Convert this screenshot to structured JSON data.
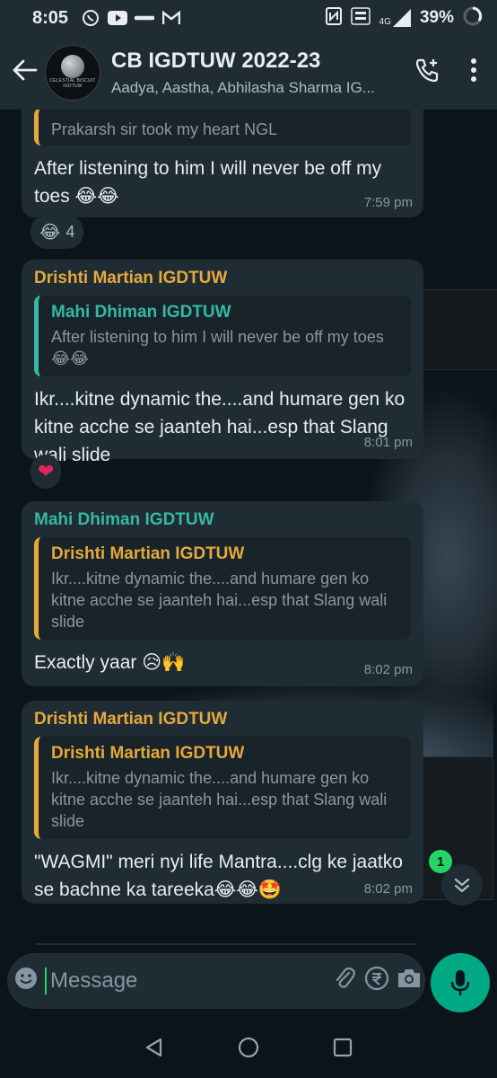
{
  "status_bar": {
    "time": "8:05",
    "network": "4G",
    "battery": "39%"
  },
  "header": {
    "title": "CB IGDTUW 2022-23",
    "subtitle": "Aadya, Aastha, Abhilasha Sharma IG...",
    "avatar_text": "CELESTIAL BISCUIT IGDTUW"
  },
  "messages": [
    {
      "quote_text": "Prakarsh sir took my heart NGL",
      "text": "After listening to him I will never be off my toes 😂😂",
      "time": "7:59 pm",
      "reaction_emoji": "😂",
      "reaction_count": "4"
    },
    {
      "sender": "Drishti Martian IGDTUW",
      "quote_sender": "Mahi Dhiman IGDTUW",
      "quote_text": "After listening to him I will never be off my toes 😂😂",
      "text": "Ikr....kitne dynamic the....and humare gen ko kitne acche se jaanteh hai...esp that Slang wali slide",
      "time": "8:01 pm",
      "reaction_emoji": "❤"
    },
    {
      "sender": "Mahi Dhiman IGDTUW",
      "quote_sender": "Drishti Martian IGDTUW",
      "quote_text": "Ikr....kitne dynamic the....and humare gen ko kitne acche se jaanteh hai...esp that Slang wali slide",
      "text": "Exactly yaar 😥🙌",
      "time": "8:02 pm"
    },
    {
      "sender": "Drishti Martian IGDTUW",
      "quote_sender": "Drishti Martian IGDTUW",
      "quote_text": "Ikr....kitne dynamic the....and humare gen ko kitne acche se jaanteh hai...esp that Slang wali slide",
      "text": "\"WAGMI\" meri nyi life Mantra....clg ke jaatko se bachne ka tareeka😂😂🤩",
      "time": "8:02 pm"
    }
  ],
  "scroll": {
    "unread_count": "1"
  },
  "composer": {
    "placeholder": "Message"
  }
}
